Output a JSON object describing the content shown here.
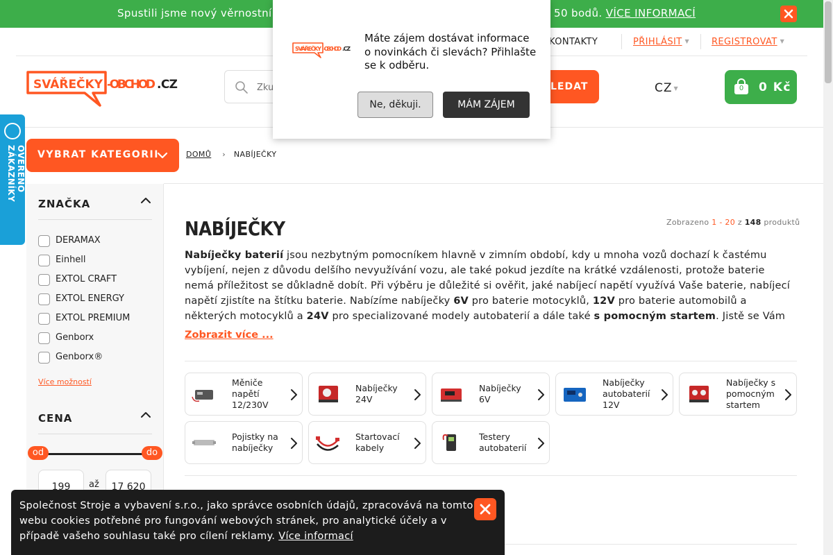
{
  "promo": {
    "text_left": "Spustili jsme nový věrnostní p",
    "text_right": "50 bodů.",
    "link": "VÍCE INFORMACÍ"
  },
  "topnav": {
    "contacts": "KONTAKTY",
    "login": "PŘIHLÁSIT",
    "register": "REGISTROVAT"
  },
  "header": {
    "logo_text": "SVÁŘEČKY-OBCHOD.CZ",
    "search_placeholder": "Zku",
    "search_button": "LEDAT",
    "language": "CZ",
    "cart_count": "0",
    "cart_total": "0 Kč"
  },
  "side_tab": {
    "label": "OVĚŘENO ZÁKAZNÍKY"
  },
  "category_button": "VYBRAT KATEGORII",
  "breadcrumb": {
    "home": "DOMŮ",
    "current": "NABÍJEČKY"
  },
  "filters": {
    "brand_title": "ZNAČKA",
    "brands": [
      "DERAMAX",
      "Einhell",
      "EXTOL CRAFT",
      "EXTOL ENERGY",
      "EXTOL PREMIUM",
      "Genborx",
      "Genborx®"
    ],
    "more": "Více možností",
    "price_title": "CENA",
    "price_from_label": "od",
    "price_to_label": "do",
    "price_min": "199",
    "price_max": "17 620",
    "price_sep": "až"
  },
  "main": {
    "title": "NABÍJEČKY",
    "showing_prefix": "Zobrazeno",
    "showing_range": "1 - 20",
    "showing_of": "z",
    "showing_total": "148",
    "showing_suffix": "produktů",
    "desc_b1": "Nabíječky baterií",
    "desc_t1": " jsou nezbytným pomocníkem hlavně v zimním období, kdy u mnoha vozů dochazí k častému vybíjení, nejen z důvodu delšího nevyužívání vozu, ale také pokud jezdíte na krátké vzdálenosti, protože baterie nemá příležitost se důkladně dobít. Při výběru je důležité si ověřit, jaké nabíjecí napětí využívá Vaše baterie, nabíjecí napětí zjistíte na štítku baterie. Nabízíme nabíječky ",
    "desc_b2": "6V",
    "desc_t2": " pro baterie motocyklů, ",
    "desc_b3": "12V",
    "desc_t3": " pro baterie automobilů a některých motocyklů a ",
    "desc_b4": "24V",
    "desc_t4": " pro specializované modely autobaterií a dále také ",
    "desc_b5": "s pomocným startem",
    "desc_t5": ". Jistě se Vám",
    "show_more": "Zobrazit více ..."
  },
  "subcategories": [
    {
      "label": "Měniče napětí 12/230V",
      "icon": "inverter-icon"
    },
    {
      "label": "Nabíječky 24V",
      "icon": "charger-red-icon"
    },
    {
      "label": "Nabíječky 6V",
      "icon": "charger-6v-icon"
    },
    {
      "label": "Nabíječky autobaterií 12V",
      "icon": "charger-blue-icon"
    },
    {
      "label": "Nabíječky s pomocným startem",
      "icon": "starter-charger-icon"
    },
    {
      "label": "Pojistky na nabíječky",
      "icon": "fuse-icon"
    },
    {
      "label": "Startovací kabely",
      "icon": "jumper-cables-icon"
    },
    {
      "label": "Testery autobaterií",
      "icon": "battery-tester-icon"
    }
  ],
  "newsletter_popup": {
    "text": "Máte zájem dostávat informace o novinkách či slevách? Přihlašte se k odběru.",
    "decline": "Ne, děkuji.",
    "accept": "MÁM ZÁJEM"
  },
  "cookie_bar": {
    "text": "Společnost Stroje a vybavení s.r.o., jako správce osobních údajů, zpracovává na tomto webu cookies potřebné pro fungování webových stránek, pro analytické účely a v případě vašeho souhlasu také pro cílení reklamy. ",
    "link": "Více informací"
  },
  "colors": {
    "accent": "#ff5722",
    "green": "#3dae4a",
    "blue_tab": "#1aa0d8",
    "dark": "#1c1c1c"
  }
}
